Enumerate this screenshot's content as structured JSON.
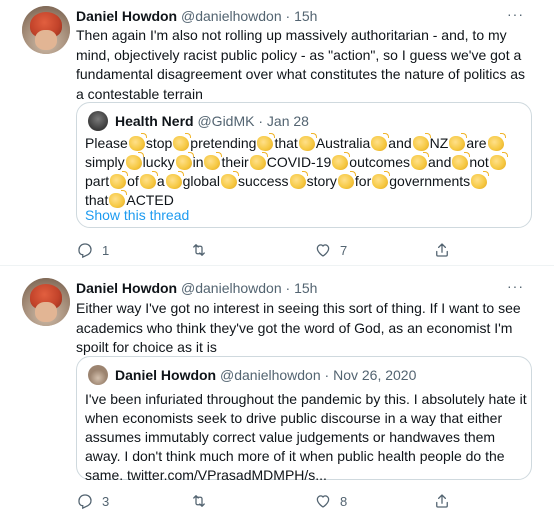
{
  "tweets": [
    {
      "name": "Daniel Howdon",
      "handle": "@danielhowdon",
      "time": "15h",
      "text": "Then again I'm also not rolling up massively authoritarian - and, to my mind, objectively racist public policy - as \"action\", so I guess we've got a fundamental disagreement over what constitutes the nature of politics as a contestable terrain",
      "quote": {
        "name": "Health Nerd",
        "handle": "@GidMK",
        "time": "Jan 28",
        "words": [
          "Please",
          "stop",
          "pretending",
          "that",
          "Australia",
          "and",
          "NZ",
          "are",
          "simply",
          "lucky",
          "in",
          "their",
          "COVID-19",
          "outcomes",
          "and",
          "not",
          "part",
          "of",
          "a",
          "global",
          "success",
          "story",
          "for",
          "governments",
          "that",
          "ACTED"
        ],
        "show_thread": "Show this thread"
      },
      "reply_count": "1",
      "retweet_count": "",
      "like_count": "7"
    },
    {
      "name": "Daniel Howdon",
      "handle": "@danielhowdon",
      "time": "15h",
      "text": "Either way I've got no interest in seeing this sort of thing. If I want to see academics who think they've got the word of God, as an economist I'm spoilt for choice as it is",
      "quote": {
        "name": "Daniel Howdon",
        "handle": "@danielhowdon",
        "time": "Nov 26, 2020",
        "text": "I've been infuriated throughout the pandemic by this. I absolutely hate it when economists seek to drive public discourse in a way that either assumes immutably correct value judgements or handwaves them away. I don't think much more of it when public health people do the same. twitter.com/VPrasadMDMPH/s..."
      },
      "reply_count": "3",
      "retweet_count": "",
      "like_count": "8"
    }
  ],
  "more_glyph": "···",
  "separator": " · ",
  "icons": {
    "reply": "reply-icon",
    "retweet": "retweet-icon",
    "like": "heart-icon",
    "share": "share-icon",
    "clap": "clapping-hands-emoji"
  },
  "colors": {
    "text": "#0f1419",
    "secondary": "#536471",
    "link": "#1d9bf0",
    "border": "#cfd9de"
  }
}
